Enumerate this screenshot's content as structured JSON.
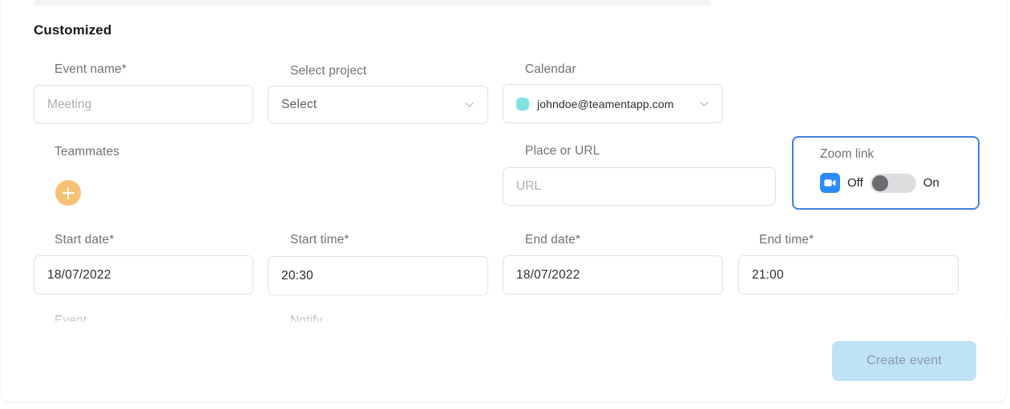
{
  "section": {
    "title": "Customized"
  },
  "fields": {
    "event_name": {
      "label": "Event name*",
      "placeholder": "Meeting",
      "value": ""
    },
    "select_project": {
      "label": "Select project",
      "value": "Select",
      "chevron": "chevron-down-icon"
    },
    "calendar": {
      "label": "Calendar",
      "value": "johndoe@teamentapp.com",
      "swatch_color": "#7fe3e3",
      "chevron": "chevron-down-icon"
    },
    "teammates": {
      "label": "Teammates",
      "add_button_label": "+",
      "add_button_color": "#f7c278"
    },
    "place_or_url": {
      "label": "Place or URL",
      "placeholder": "URL",
      "value": ""
    },
    "start_date": {
      "label": "Start date*",
      "value": "18/07/2022"
    },
    "start_time": {
      "label": "Start time*",
      "value": "20:30"
    },
    "end_date": {
      "label": "End date*",
      "value": "18/07/2022"
    },
    "end_time": {
      "label": "End time*",
      "value": "21:00"
    },
    "clipped_left": {
      "label": "Event"
    },
    "clipped_right": {
      "label": "Notify"
    }
  },
  "zoom_link": {
    "label": "Zoom link",
    "off_label": "Off",
    "on_label": "On",
    "state": "off",
    "icon": "zoom-video-icon",
    "highlight_color": "#3f80e0",
    "icon_color": "#2d8cff"
  },
  "footer": {
    "create_button_label": "Create event",
    "create_button_color": "#bfe2f7",
    "create_button_text_color": "#8a9aa6"
  }
}
